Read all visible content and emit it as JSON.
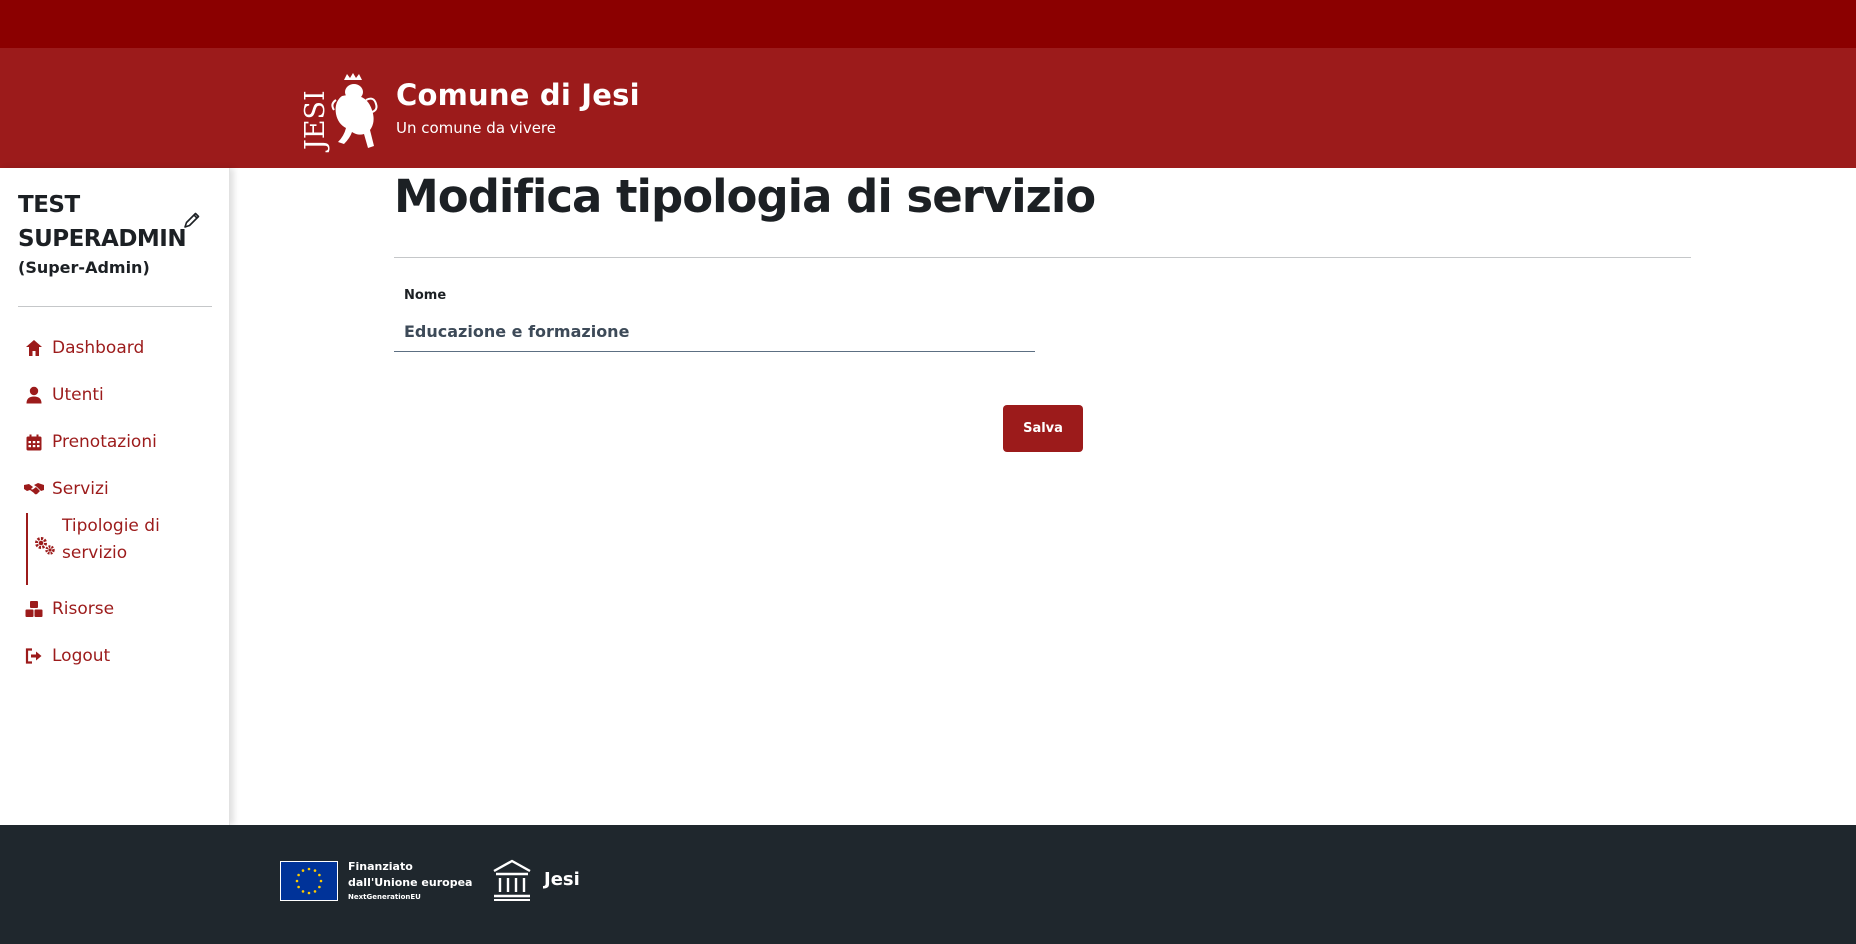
{
  "header": {
    "logo_icon": "jesi-lion-crest-icon",
    "logo_text": "JESI",
    "title": "Comune di Jesi",
    "tagline": "Un comune da vivere"
  },
  "sidebar": {
    "user_name": "TEST SUPERADMIN",
    "user_role": "(Super-Admin)",
    "edit_icon": "pencil-icon",
    "items": [
      {
        "label": "Dashboard",
        "icon": "home-icon"
      },
      {
        "label": "Utenti",
        "icon": "user-icon"
      },
      {
        "label": "Prenotazioni",
        "icon": "calendar-icon"
      },
      {
        "label": "Servizi",
        "icon": "handshake-icon"
      },
      {
        "label": "Risorse",
        "icon": "cubes-icon"
      },
      {
        "label": "Logout",
        "icon": "sign-out-icon"
      }
    ],
    "sub_item": {
      "label": "Tipologie di servizio",
      "icon": "gears-icon"
    }
  },
  "main": {
    "title": "Modifica tipologia di servizio",
    "field_label": "Nome",
    "field_value": "Educazione e formazione",
    "save_label": "Salva"
  },
  "footer": {
    "eu_line1": "Finanziato",
    "eu_line2": "dall'Unione europea",
    "eu_line3": "NextGenerationEU",
    "eu_flag_icon": "eu-flag-icon",
    "logo_icon": "institution-icon",
    "name": "Jesi"
  },
  "colors": {
    "topbar": "#8b0000",
    "header": "#9c1b1b",
    "accent": "#9c1b1b",
    "footer": "#1f272d",
    "eu_blue": "#003399",
    "eu_yellow": "#ffcc00"
  }
}
